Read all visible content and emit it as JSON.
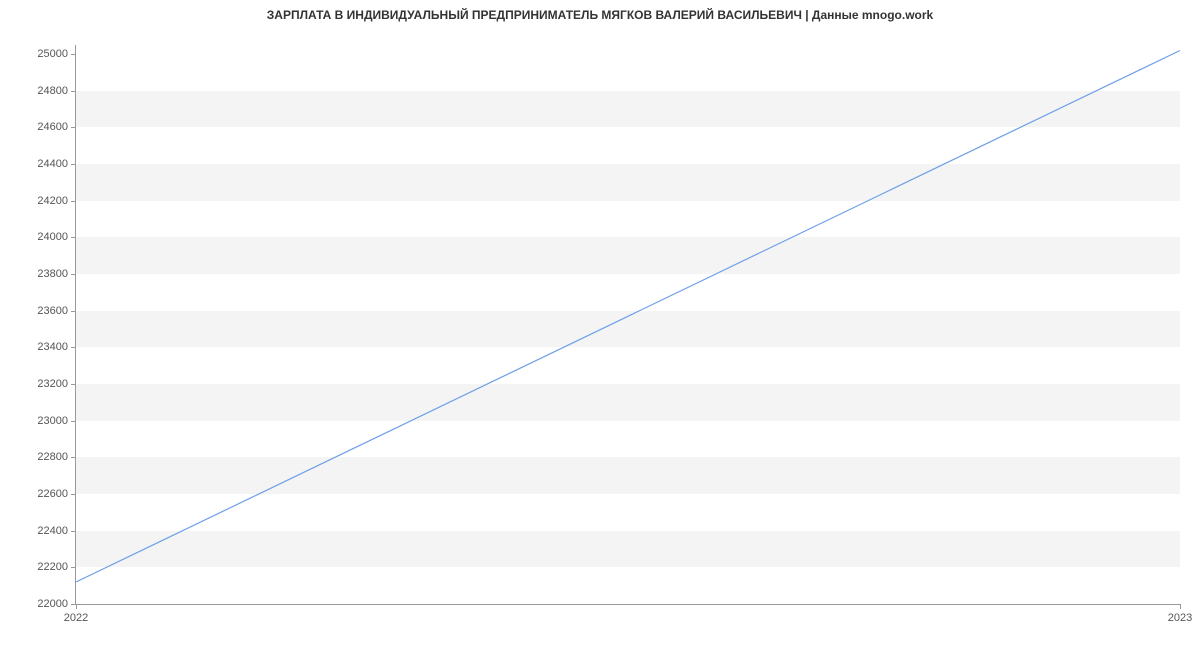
{
  "chart_data": {
    "type": "line",
    "title": "ЗАРПЛАТА В ИНДИВИДУАЛЬНЫЙ ПРЕДПРИНИМАТЕЛЬ МЯГКОВ ВАЛЕРИЙ ВАСИЛЬЕВИЧ | Данные mnogo.work",
    "xlabel": "",
    "ylabel": "",
    "x": [
      2022,
      2023
    ],
    "values": [
      22120,
      25020
    ],
    "xlim": [
      2022,
      2023
    ],
    "ylim": [
      22000,
      25050
    ],
    "x_ticks": [
      2022,
      2023
    ],
    "y_ticks": [
      22000,
      22200,
      22400,
      22600,
      22800,
      23000,
      23200,
      23400,
      23600,
      23800,
      24000,
      24200,
      24400,
      24600,
      24800,
      25000
    ],
    "line_color": "#6f9fe8"
  }
}
